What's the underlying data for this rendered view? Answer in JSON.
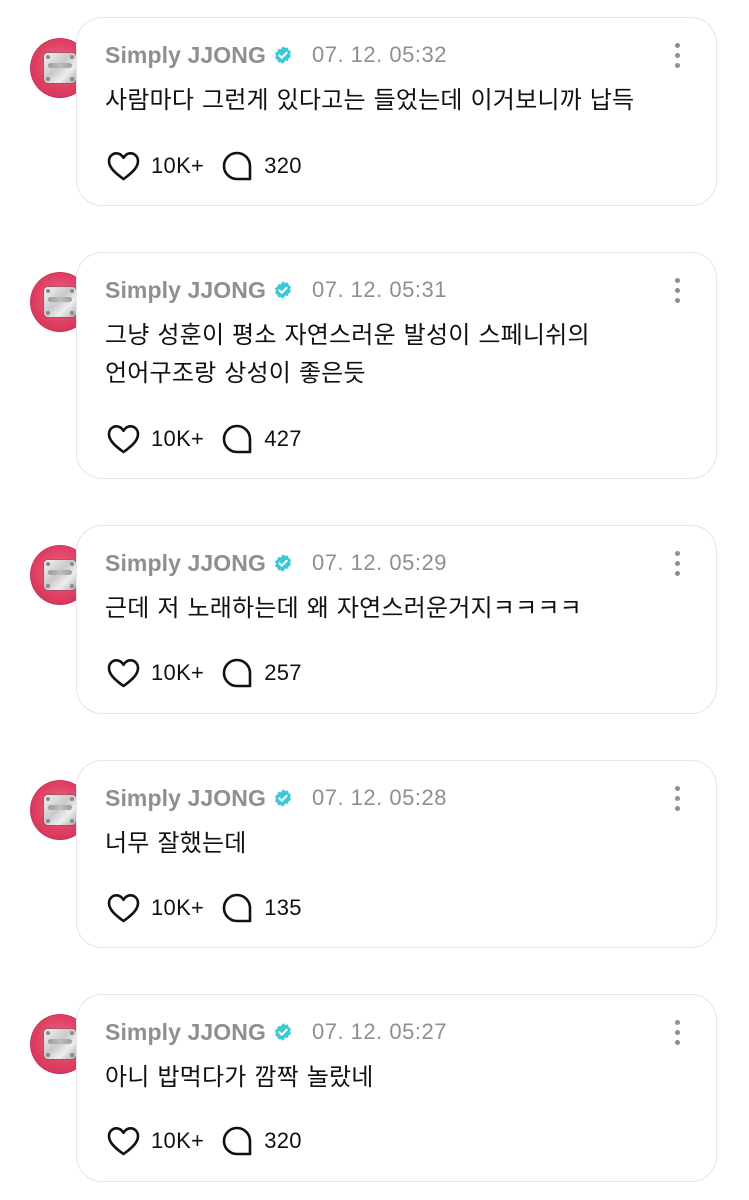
{
  "posts": [
    {
      "author": "Simply JJONG",
      "time": "07. 12. 05:32",
      "text": "사람마다 그런게 있다고는 들었는데 이거보니까 납득",
      "likes": "10K+",
      "comments": "320"
    },
    {
      "author": "Simply JJONG",
      "time": "07. 12. 05:31",
      "text": "그냥 성훈이 평소 자연스러운 발성이 스페니쉬의\n언어구조랑 상성이 좋은듯",
      "likes": "10K+",
      "comments": "427"
    },
    {
      "author": "Simply JJONG",
      "time": "07. 12. 05:29",
      "text": "근데 저 노래하는데 왜 자연스러운거지ㅋㅋㅋㅋ",
      "likes": "10K+",
      "comments": "257"
    },
    {
      "author": "Simply JJONG",
      "time": "07. 12. 05:28",
      "text": "너무 잘했는데",
      "likes": "10K+",
      "comments": "135"
    },
    {
      "author": "Simply JJONG",
      "time": "07. 12. 05:27",
      "text": "아니 밥먹다가 깜짝 놀랐네",
      "likes": "10K+",
      "comments": "320"
    }
  ],
  "icons": {
    "verified": "verified-badge-icon",
    "like": "heart-icon",
    "comment": "speech-bubble-icon",
    "more": "vertical-ellipsis-icon"
  },
  "colors": {
    "verified_badge": "#3cc8d6",
    "muted_text": "#8e8e93",
    "card_border": "#e5e5ea"
  }
}
